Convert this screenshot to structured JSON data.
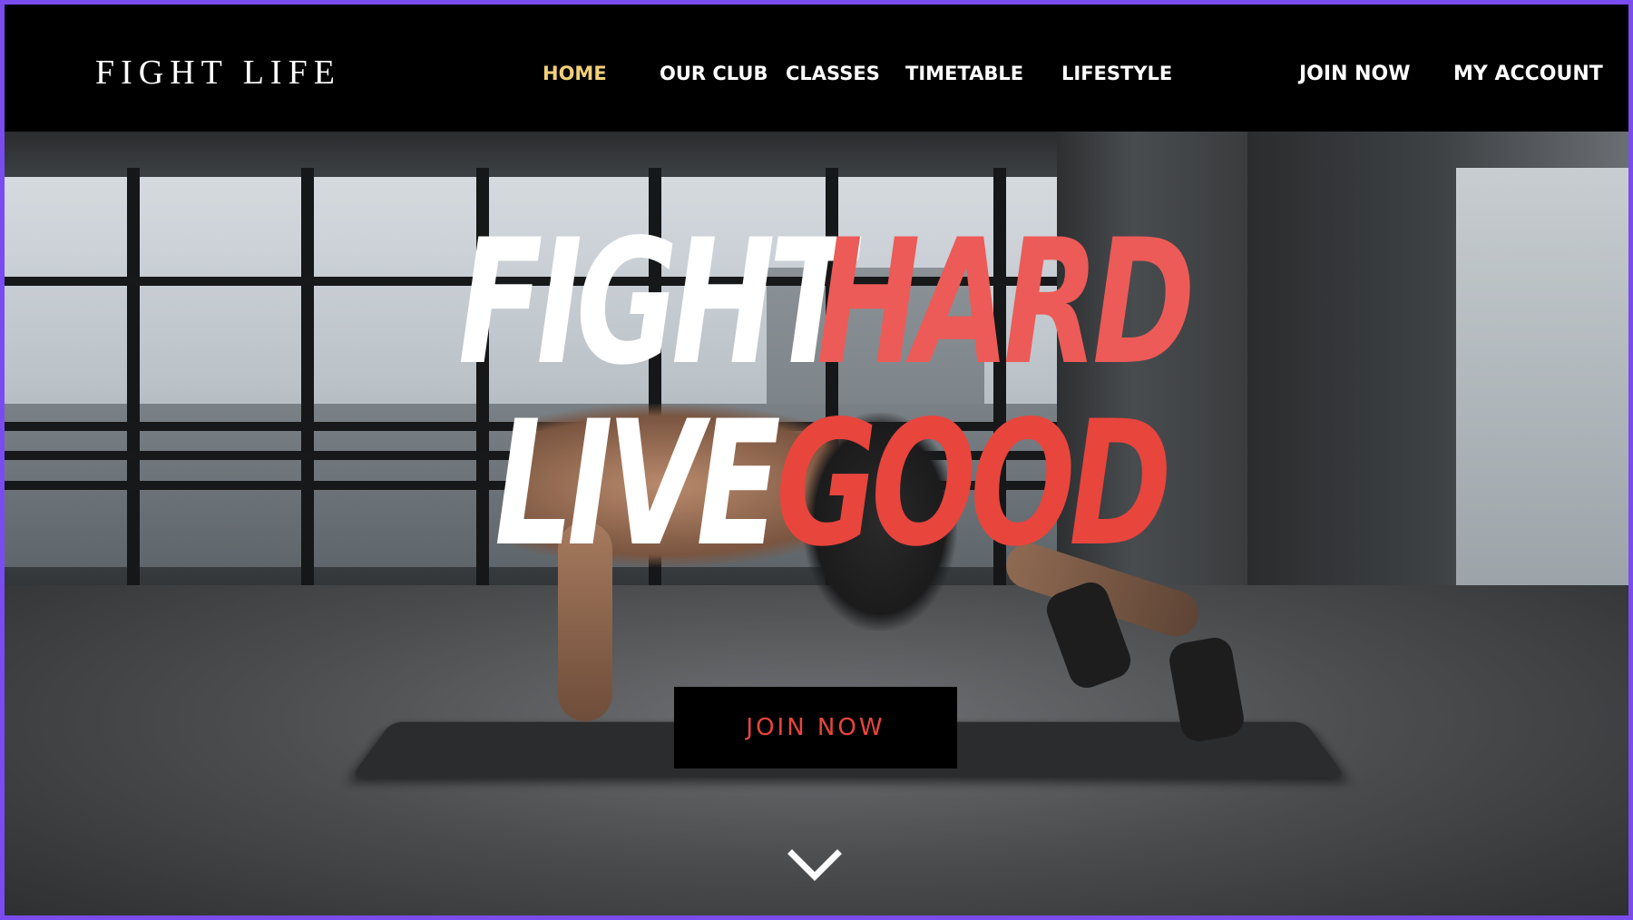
{
  "brand": {
    "name": "FIGHT LIFE"
  },
  "nav": {
    "items": [
      {
        "label": "HOME",
        "active": true
      },
      {
        "label": "OUR CLUB",
        "active": false
      },
      {
        "label": "CLASSES",
        "active": false
      },
      {
        "label": "TIMETABLE",
        "active": false
      },
      {
        "label": "LIFESTYLE",
        "active": false
      }
    ],
    "right": {
      "join_label": "JOIN NOW",
      "account_label": "MY ACCOUNT"
    }
  },
  "hero": {
    "line1": {
      "word1": "FIGHT",
      "word2": "HARD"
    },
    "line2": {
      "word1": "LIVE",
      "word2": "GOOD"
    },
    "cta_label": "JOIN NOW",
    "scroll_icon": "chevron-down-icon"
  },
  "colors": {
    "frame": "#7a4cf0",
    "nav_active": "#f2d079",
    "headline_accent_1": "#ec5b57",
    "headline_accent_2": "#e8453d",
    "cta_text": "#e8453d"
  }
}
